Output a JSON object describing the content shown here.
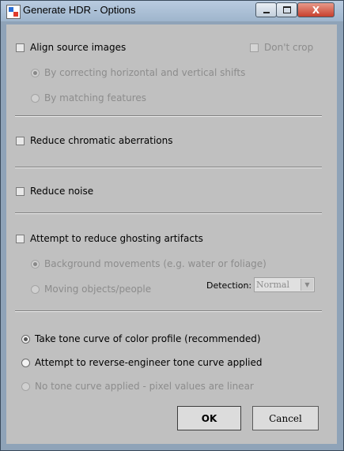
{
  "window": {
    "title": "Generate HDR - Options"
  },
  "title_buttons": {
    "minimize": "minimize",
    "maximize": "maximize",
    "close": "X"
  },
  "align": {
    "label": "Align source images",
    "checked": false,
    "dont_crop": "Don't crop",
    "options": [
      {
        "label": "By correcting horizontal and vertical shifts",
        "selected": true
      },
      {
        "label": "By matching features",
        "selected": false
      }
    ]
  },
  "chromatic": {
    "label": "Reduce chromatic aberrations",
    "checked": false
  },
  "noise": {
    "label": "Reduce noise",
    "checked": false
  },
  "ghosting": {
    "label": "Attempt to reduce ghosting artifacts",
    "checked": false,
    "options": [
      {
        "label": "Background movements (e.g. water or foliage)",
        "selected": true
      },
      {
        "label": "Moving objects/people",
        "selected": false
      }
    ],
    "detection_label": "Detection:",
    "detection_value": "Normal"
  },
  "tone": {
    "options": [
      {
        "label": "Take tone curve of color profile (recommended)",
        "selected": true,
        "enabled": true
      },
      {
        "label": "Attempt to reverse-engineer tone curve applied",
        "selected": false,
        "enabled": true
      },
      {
        "label": "No tone curve applied - pixel values are linear",
        "selected": false,
        "enabled": false
      }
    ]
  },
  "buttons": {
    "ok": "OK",
    "cancel": "Cancel"
  }
}
